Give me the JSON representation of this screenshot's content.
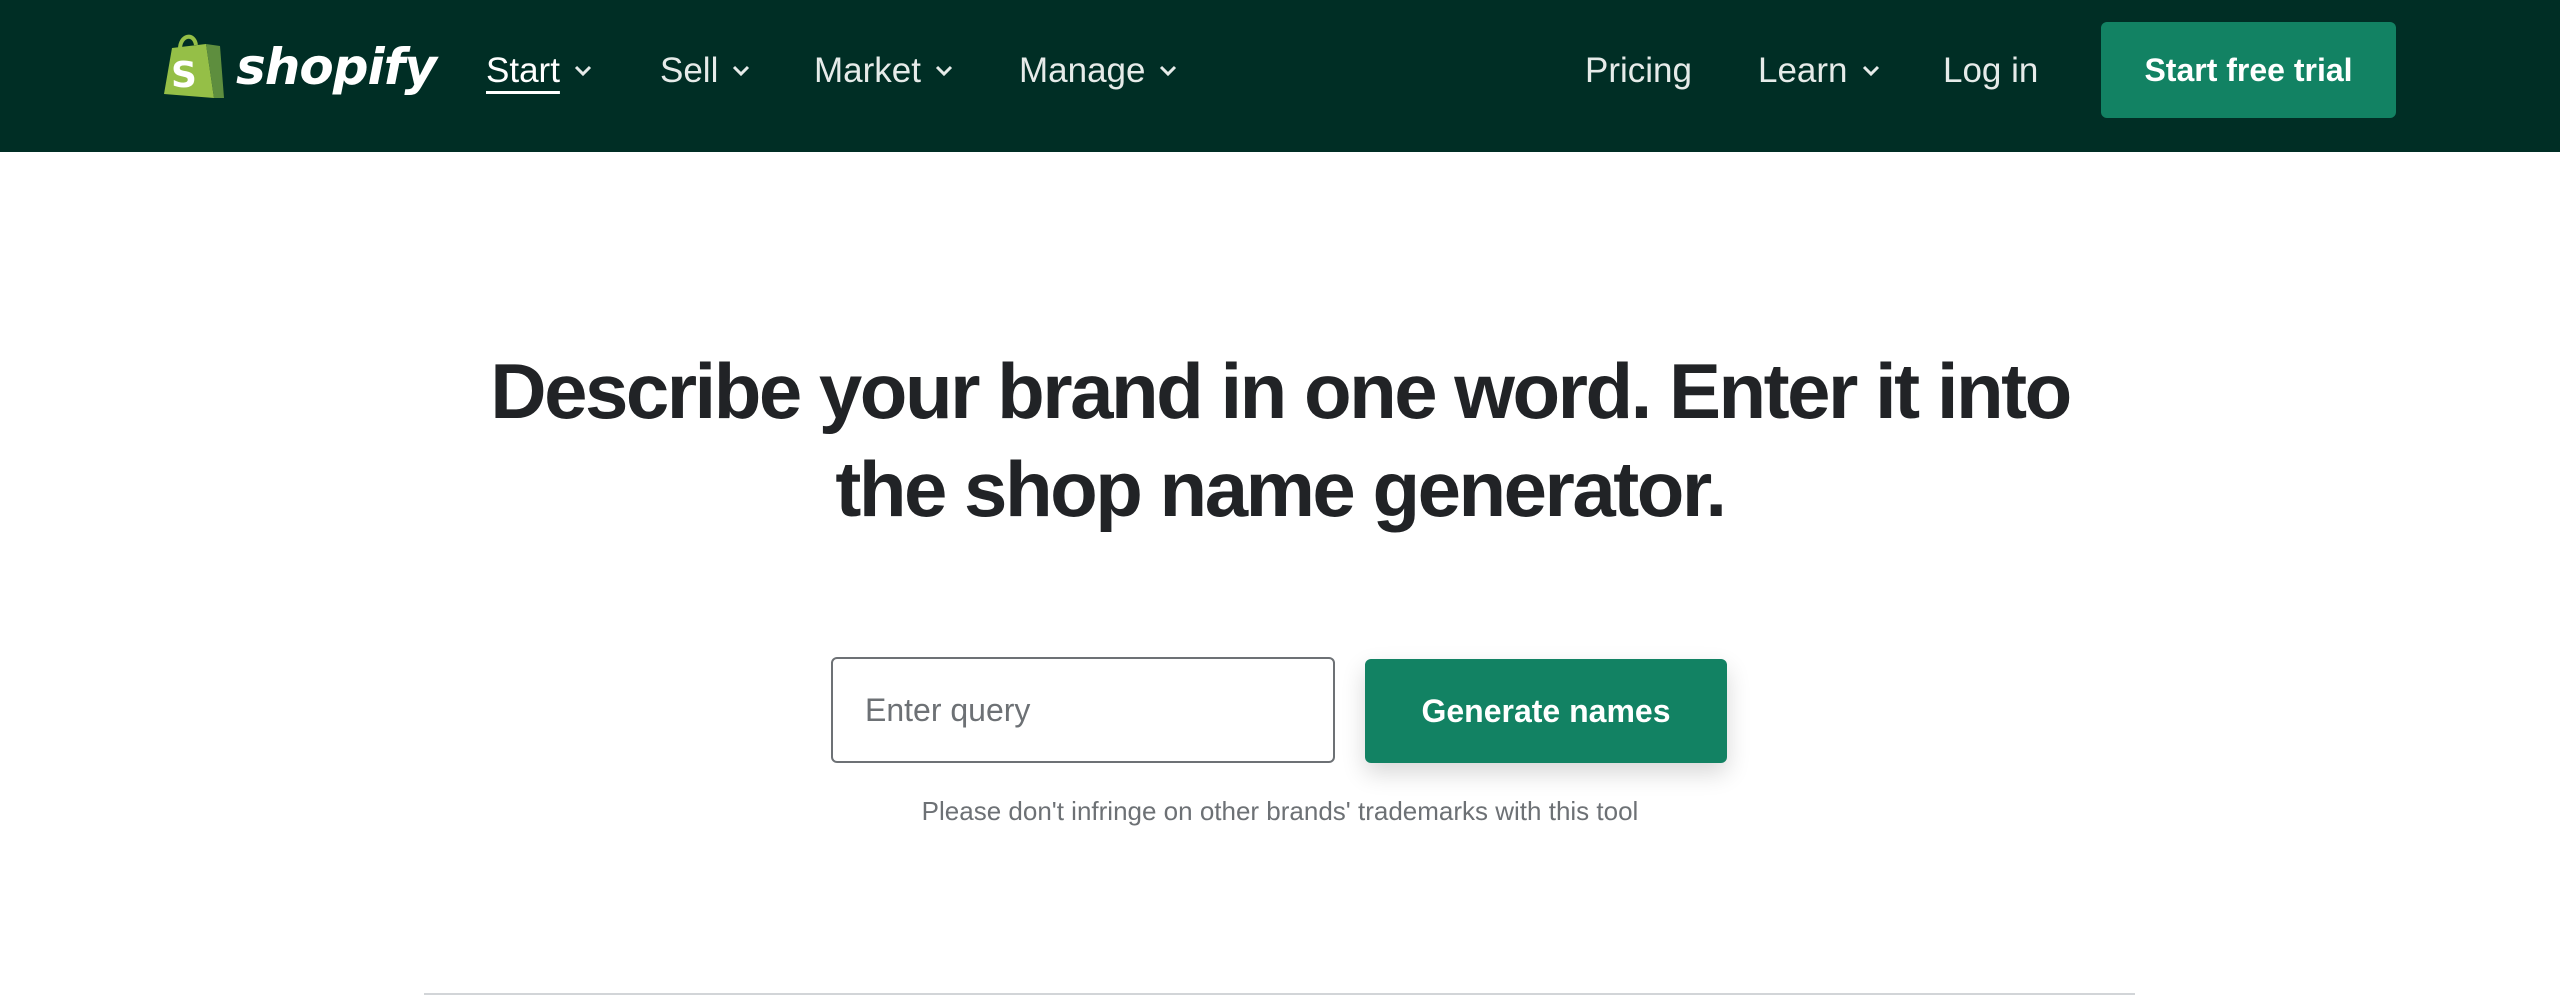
{
  "brand": {
    "name": "shopify",
    "bag_letter": "S",
    "colors": {
      "nav_background": "#002e25",
      "accent": "#128263",
      "bag_light": "#95bf47",
      "bag_dark": "#5e8e3e"
    }
  },
  "nav": {
    "items": [
      {
        "label": "Start",
        "has_dropdown": true,
        "active": true
      },
      {
        "label": "Sell",
        "has_dropdown": true
      },
      {
        "label": "Market",
        "has_dropdown": true
      },
      {
        "label": "Manage",
        "has_dropdown": true
      }
    ],
    "right_items": [
      {
        "label": "Pricing",
        "has_dropdown": false
      },
      {
        "label": "Learn",
        "has_dropdown": true
      },
      {
        "label": "Log in",
        "has_dropdown": false
      }
    ],
    "cta_label": "Start free trial"
  },
  "hero": {
    "headline_line1": "Describe your brand in one word. Enter it into",
    "headline_line2": "the shop name generator."
  },
  "generator": {
    "query_value": "",
    "query_placeholder": "Enter query",
    "button_label": "Generate names",
    "disclaimer": "Please don't infringe on other brands' trademarks with this tool"
  },
  "icons": {
    "logo": "shopify-bag-icon",
    "dropdown": "chevron-down-icon"
  }
}
